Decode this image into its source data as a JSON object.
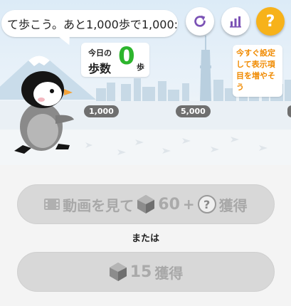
{
  "speech_bubble": {
    "text": "て歩こう。あと1,000歩で1,000:"
  },
  "steps_card": {
    "today_label": "今日の",
    "steps_label": "歩数",
    "count": "0",
    "unit": "歩"
  },
  "toolbar": {
    "refresh_icon": "refresh-icon",
    "stats_icon": "bar-chart-icon",
    "help_label": "?"
  },
  "setup_note": {
    "lines": [
      "今すぐ設定",
      "して表示項",
      "目を増やそ",
      "う"
    ]
  },
  "markers": {
    "m1000": "1,000",
    "m5000": "5,000"
  },
  "actions": {
    "video_label": "動画を見て",
    "video_gem_count": "60",
    "video_plus": "+",
    "video_question": "?",
    "video_get": "獲得",
    "or_label": "または",
    "gem_count": "15",
    "gem_get": "獲得"
  },
  "colors": {
    "accent_green": "#2db52d",
    "help_orange": "#f7b21a",
    "note_orange": "#f08a00",
    "icon_purple": "#7b52b5"
  }
}
